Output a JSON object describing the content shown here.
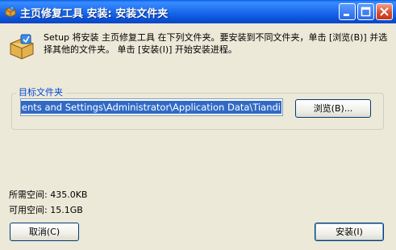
{
  "window": {
    "title": "主页修复工具 安装: 安装文件夹"
  },
  "description": "Setup 将安装 主页修复工具 在下列文件夹。要安装到不同文件夹，单击 [浏览(B)] 并选择其他的文件夹。 单击 [安装(I)] 开始安装进程。",
  "destination": {
    "group_label": "目标文件夹",
    "path_value": "uments and Settings\\Administrator\\Application Data\\Tiandi",
    "browse_label": "浏览(B)..."
  },
  "space": {
    "required": "所需空间: 435.0KB",
    "available": "可用空间: 15.1GB"
  },
  "buttons": {
    "cancel": "取消(C)",
    "install": "安装(I)"
  },
  "icons": {
    "title": "installer-box-icon",
    "minimize": "minimize-icon",
    "maximize": "maximize-icon",
    "close": "close-icon",
    "setup": "installer-box-icon"
  }
}
